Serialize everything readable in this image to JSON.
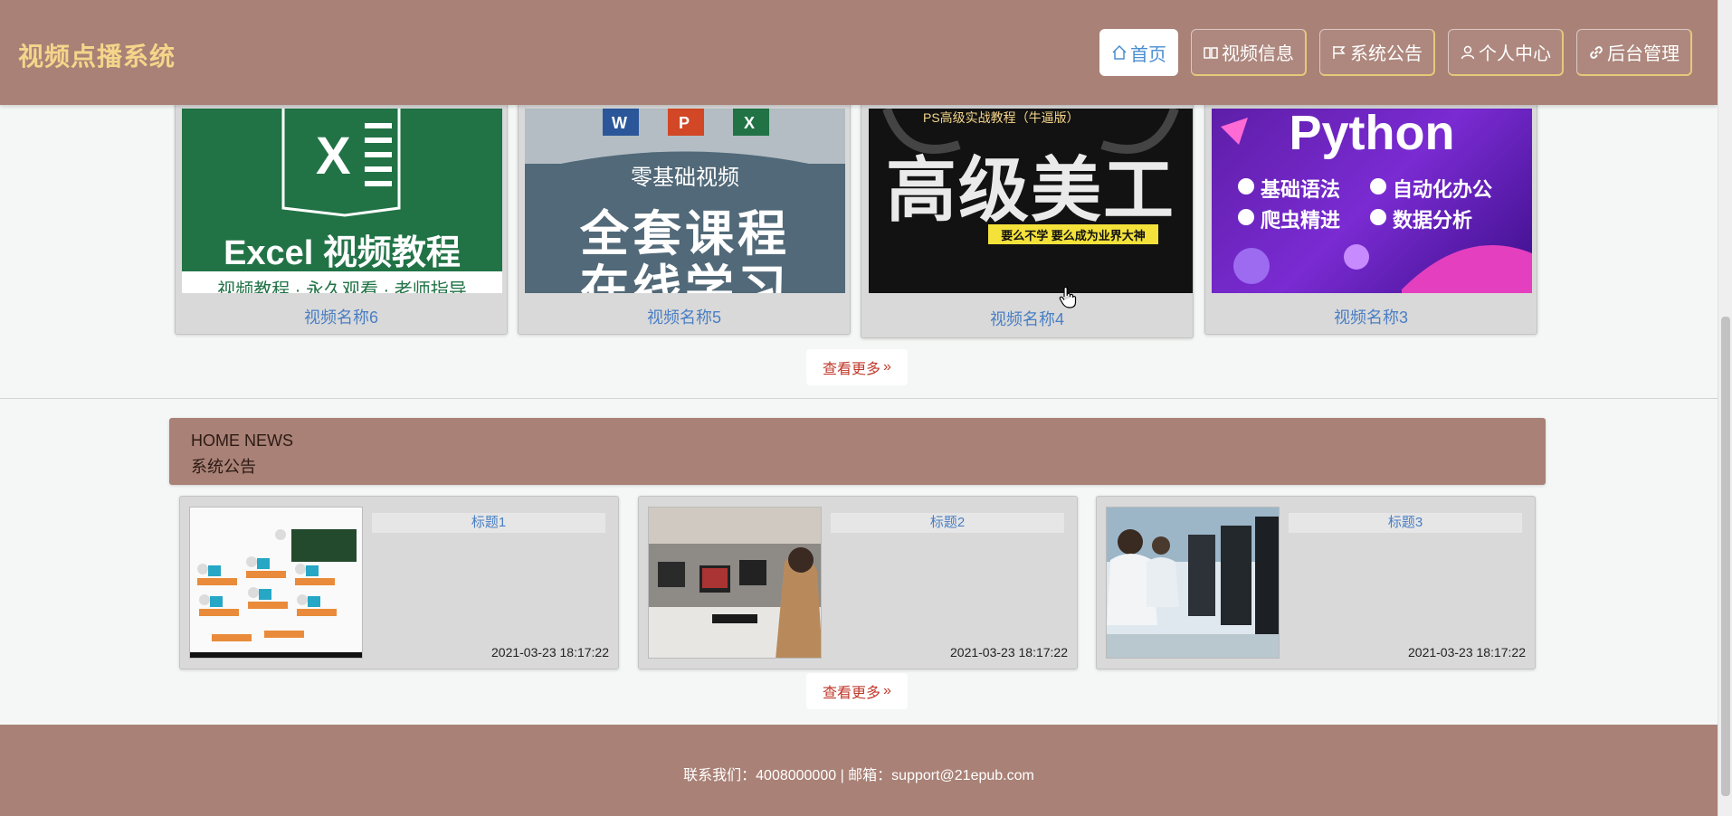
{
  "header": {
    "site_title": "视频点播系统",
    "nav": [
      {
        "label": "首页",
        "icon": "home-icon",
        "active": true
      },
      {
        "label": "视频信息",
        "icon": "book-icon",
        "active": false
      },
      {
        "label": "系统公告",
        "icon": "flag-icon",
        "active": false
      },
      {
        "label": "个人中心",
        "icon": "user-icon",
        "active": false
      },
      {
        "label": "后台管理",
        "icon": "link-icon",
        "active": false
      }
    ]
  },
  "videos": {
    "items": [
      {
        "name": "视频名称6",
        "thumb": {
          "title": "Excel 视频教程",
          "subtitle": "视频教程 · 永久观看 · 老师指导"
        }
      },
      {
        "name": "视频名称5",
        "thumb": {
          "top": "零基础视频",
          "line1": "全套课程",
          "line2": "在线学习"
        }
      },
      {
        "name": "视频名称4",
        "thumb": {
          "top": "PS高级实战教程（牛逼版）",
          "main": "高级美工",
          "tag": "要么不学 要么成为业界大神"
        }
      },
      {
        "name": "视频名称3",
        "thumb": {
          "title": "Python",
          "f1": "基础语法",
          "f2": "自动化办公",
          "f3": "爬虫精进",
          "f4": "数据分析"
        }
      }
    ],
    "more_label": "查看更多"
  },
  "news": {
    "heading_en": "HOME NEWS",
    "heading_cn": "系统公告",
    "items": [
      {
        "title": "标题1",
        "date": "2021-03-23 18:17:22"
      },
      {
        "title": "标题2",
        "date": "2021-03-23 18:17:22"
      },
      {
        "title": "标题3",
        "date": "2021-03-23 18:17:22"
      }
    ],
    "more_label": "查看更多"
  },
  "footer": {
    "contact": "联系我们：4008000000 | 邮箱：support@21epub.com"
  },
  "colors": {
    "brand": "#a98176",
    "title": "#f5d58a",
    "link": "#4a7fc4",
    "more": "#c0392b"
  }
}
